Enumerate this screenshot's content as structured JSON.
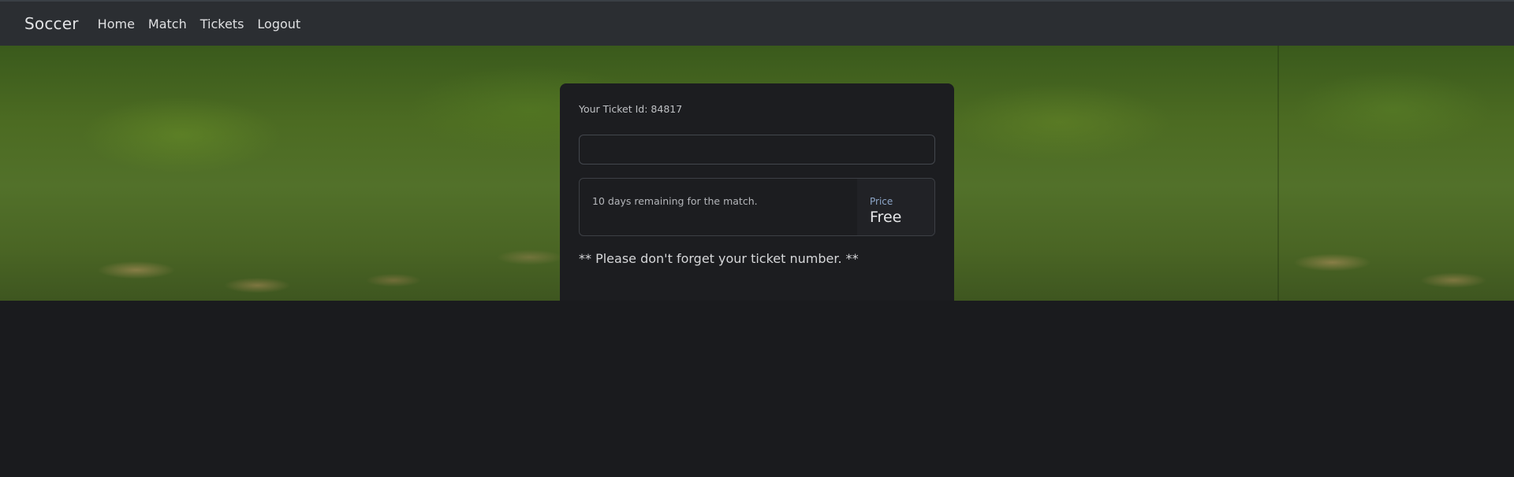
{
  "navbar": {
    "brand": "Soccer",
    "links": [
      "Home",
      "Match",
      "Tickets",
      "Logout"
    ]
  },
  "ticket": {
    "id_label": "Your Ticket Id: 84817",
    "code_value": "",
    "remaining": "10 days remaining for the match.",
    "price_label": "Price",
    "price_value": "Free",
    "reminder": "** Please don't forget your ticket number. **"
  },
  "colors": {
    "navbar_bg": "#2b2e32",
    "page_bg": "#1a1b1e",
    "card_bg": "#1c1d20",
    "price_label": "#8ea7c9"
  }
}
